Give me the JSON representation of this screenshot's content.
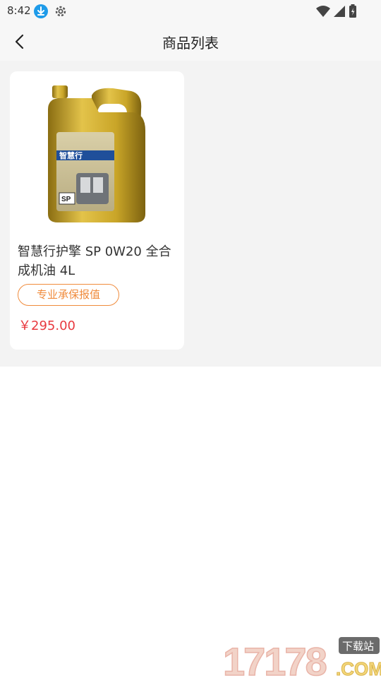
{
  "status_bar": {
    "time": "8:42",
    "icons": [
      "download-icon",
      "gear-icon",
      "wifi-icon",
      "signal-icon",
      "battery-icon"
    ]
  },
  "header": {
    "title": "商品列表",
    "back_icon": "chevron-left-icon"
  },
  "products": [
    {
      "name": "智慧行护擎 SP 0W20 全合成机油 4L",
      "badge": "专业承保报值",
      "price": "￥295.00",
      "image": "motor-oil-bottle",
      "label_text": "智慧行",
      "grade_text": "SP"
    }
  ],
  "watermark": {
    "number": "17178",
    "tag": "下载站",
    "domain": ".COM"
  },
  "colors": {
    "badge_orange": "#f08b3c",
    "price_red": "#e8393f",
    "bottle_gold": "#c9a528",
    "status_blue": "#1e9be9"
  }
}
